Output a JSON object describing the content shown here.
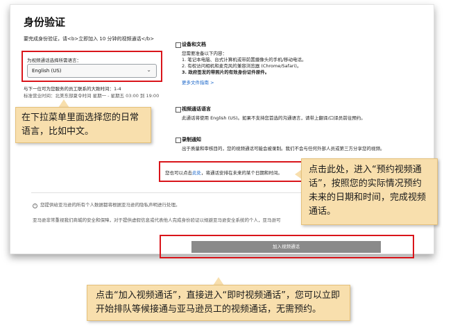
{
  "page": {
    "title": "身份验证",
    "intro": "要完成身份验证，请<b>立即加入 10 分钟的视频通话</b>"
  },
  "language": {
    "label": "为视频通话选择所需语言：",
    "selected": "English (US)"
  },
  "response_time": {
    "line1": "与下一位可为您服务的员工联系的大致时间：1-4",
    "line2": "标准营业时间：北美东部夏令时间 星期一 - 星期五 03:00 到 19:00"
  },
  "sections": {
    "devices": {
      "heading": "设备和文档",
      "subheading": "您需要准备以下内容：",
      "items": [
        "1. 笔记本电脑、台式计算机或带前置摄像头的手机/移动电话。",
        "2. 有权访问相机和麦克风的兼容浏览器 (Chrome/Safari)。",
        "3. 政府签发的带照片的有效身份证件原件。"
      ],
      "link": "更多文件指南 >"
    },
    "language_info": {
      "heading": "视频通话语言",
      "body": "此通话将使用 English (US)。如果不支持您首选的沟通语言，请带上翻译/口译员前往预约。"
    },
    "recording": {
      "heading": "录制通知",
      "body": "出于质量和审核目的，您的视频通话可能会被录制。我们不会与任何外部人员或第三方分享您的视频。"
    }
  },
  "schedule": {
    "prefix": "您也可以点击",
    "link": "此处",
    "suffix": "，将通话安排在未来的某个日期和时间。"
  },
  "privacy": {
    "line1": "您提供给亚马逊的所有个人数据都将根据亚马逊的隐私声明进行处理。",
    "line2": "亚马逊非常重视我们商城的安全和保障，对于提供虚假信息或代表他人完成身份验证以规避亚马逊安全系统的个人，亚马逊可"
  },
  "join_button": "加入视频通话",
  "callouts": {
    "language": "在下拉菜单里面选择您的日常语言，比如中文。",
    "schedule": "点击此处，进入“预约视频通话”，按照您的实际情况预约未来的日期和时间，完成视频通话。",
    "join": "点击“加入视频通话”，直接进入“即时视频通话”，您可以立即开始排队等候接通与亚马逊员工的视频通话，无需预约。"
  }
}
